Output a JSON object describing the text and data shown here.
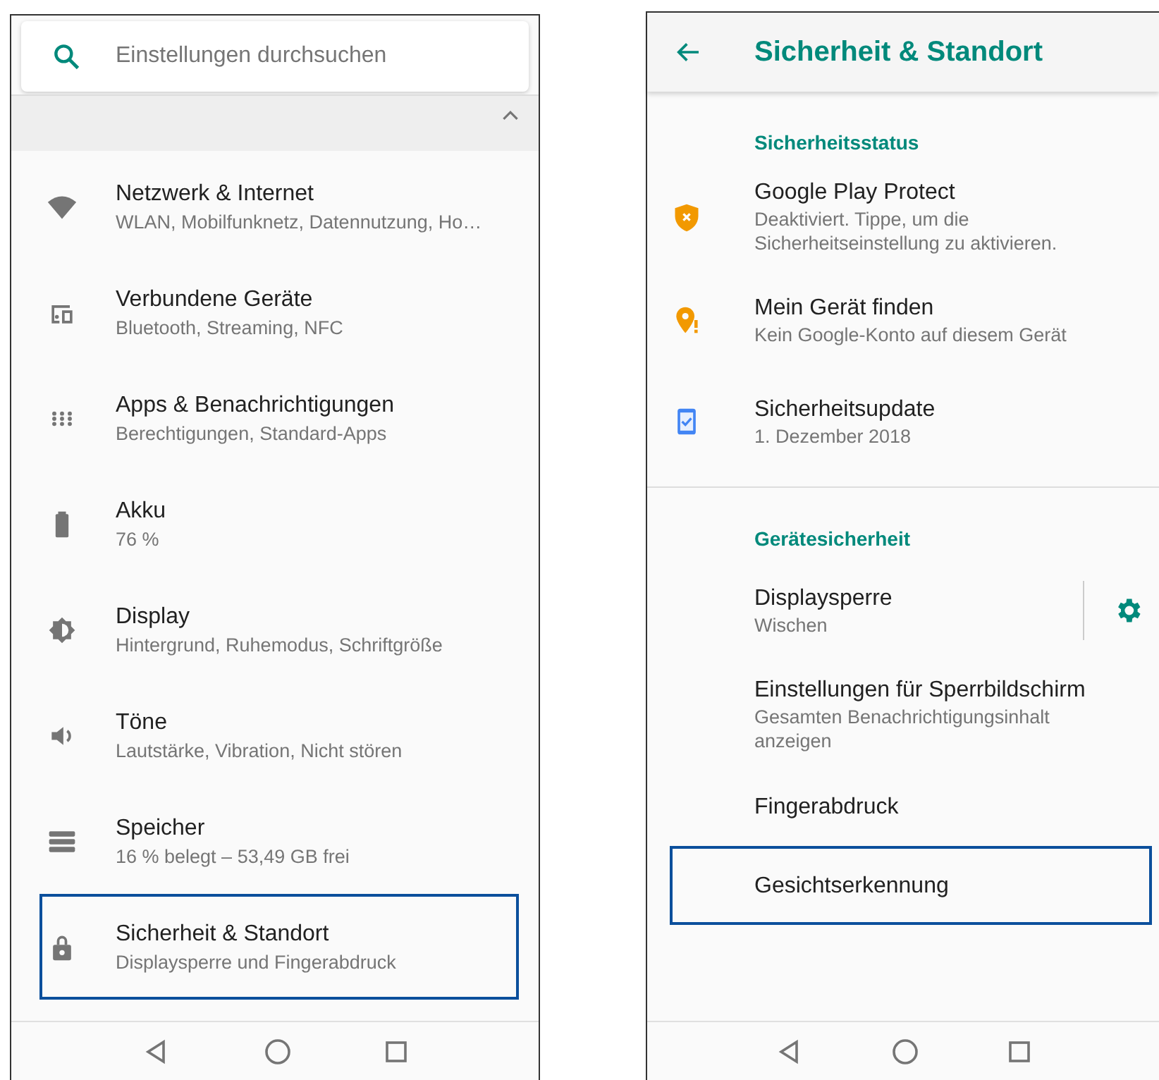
{
  "settings_screen": {
    "search": {
      "placeholder": "Einstellungen durchsuchen"
    },
    "items": [
      {
        "title": "Netzwerk & Internet",
        "subtitle": "WLAN, Mobilfunknetz, Datennutzung, Ho…",
        "selected": false
      },
      {
        "title": "Verbundene Geräte",
        "subtitle": "Bluetooth, Streaming, NFC",
        "selected": false
      },
      {
        "title": "Apps & Benachrichtigungen",
        "subtitle": "Berechtigungen, Standard-Apps",
        "selected": false
      },
      {
        "title": "Akku",
        "subtitle": "76 %",
        "selected": false
      },
      {
        "title": "Display",
        "subtitle": "Hintergrund, Ruhemodus, Schriftgröße",
        "selected": false
      },
      {
        "title": "Töne",
        "subtitle": "Lautstärke, Vibration, Nicht stören",
        "selected": false
      },
      {
        "title": "Speicher",
        "subtitle": "16 % belegt – 53,49 GB frei",
        "selected": false
      },
      {
        "title": "Sicherheit & Standort",
        "subtitle": "Displaysperre und Fingerabdruck",
        "selected": true
      }
    ]
  },
  "security_screen": {
    "title": "Sicherheit & Standort",
    "sections": [
      {
        "header": "Sicherheitsstatus",
        "items": [
          {
            "kind": "plain",
            "title": "Google Play Protect",
            "subtitle": "Deaktiviert. Tippe, um die Sicherheitseinstellung zu aktivieren.",
            "selected": false
          },
          {
            "kind": "plain",
            "title": "Mein Gerät finden",
            "subtitle": "Kein Google-Konto auf diesem Gerät",
            "selected": false
          },
          {
            "kind": "plain",
            "title": "Sicherheitsupdate",
            "subtitle": "1. Dezember 2018",
            "selected": false
          }
        ]
      },
      {
        "header": "Gerätesicherheit",
        "items": [
          {
            "kind": "gear",
            "title": "Displaysperre",
            "subtitle": "Wischen",
            "selected": false
          },
          {
            "kind": "plain",
            "title": "Einstellungen für Sperrbildschirm",
            "subtitle": "Gesamten Benachrichtigungsinhalt anzeigen",
            "selected": false
          },
          {
            "kind": "plain",
            "title": "Fingerabdruck",
            "selected": false
          },
          {
            "kind": "plain",
            "title": "Gesichtserkennung",
            "selected": true
          }
        ]
      }
    ]
  }
}
